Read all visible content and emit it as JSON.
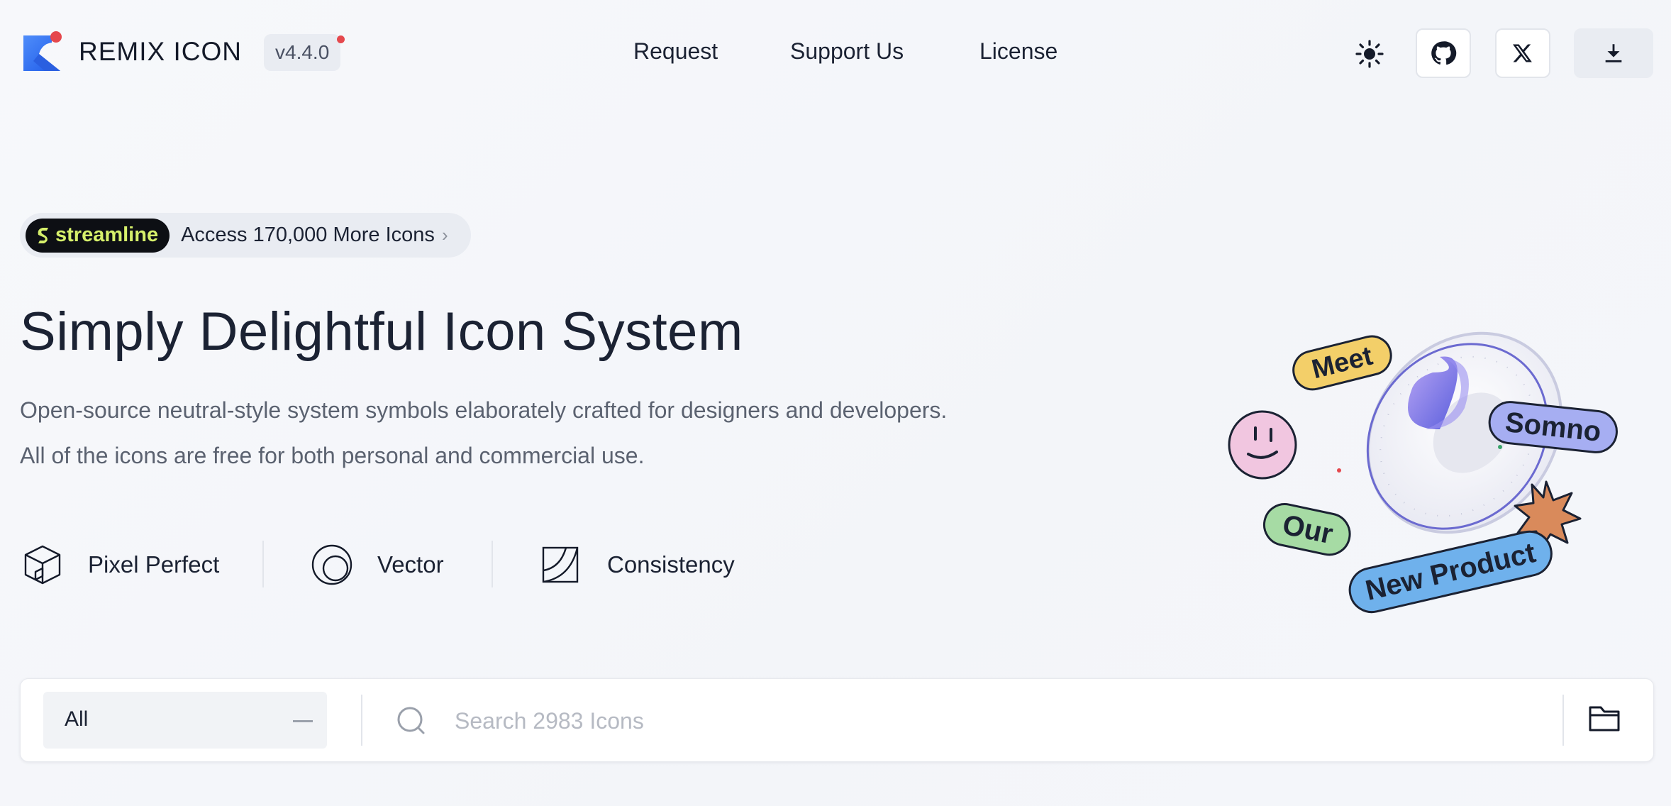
{
  "header": {
    "brand": "REMIX ICON",
    "version": "v4.4.0",
    "nav": [
      "Request",
      "Support Us",
      "License"
    ],
    "buttons": [
      "theme-toggle",
      "github",
      "x",
      "download"
    ]
  },
  "hero": {
    "badge_brand": "streamline",
    "badge_text": "Access 170,000 More Icons",
    "title": "Simply Delightful Icon System",
    "subtitle_line1": "Open-source neutral-style system symbols elaborately crafted for designers and developers.",
    "subtitle_line2": "All of the icons are free for both personal and commercial use.",
    "features": [
      "Pixel Perfect",
      "Vector",
      "Consistency"
    ]
  },
  "illustration": {
    "stickers": [
      "Meet",
      "Somno",
      "Our",
      "New Product"
    ]
  },
  "search": {
    "category": "All",
    "placeholder": "Search 2983 Icons"
  },
  "colors": {
    "brand_blue": "#2f6bf2",
    "brand_red": "#e5484d",
    "streamline_green": "#d6f06b"
  }
}
